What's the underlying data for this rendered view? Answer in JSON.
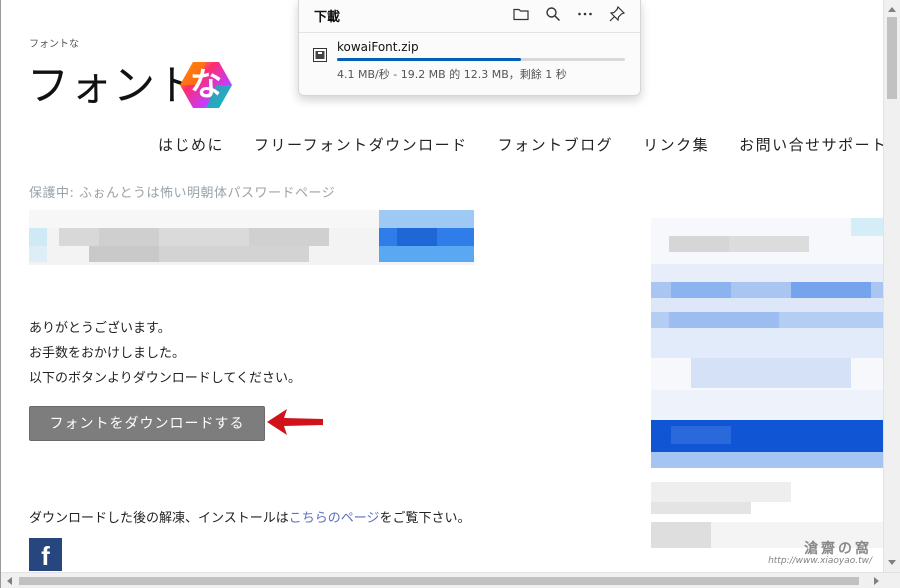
{
  "site": {
    "tagline": "フォントな",
    "logo_text": "フォント",
    "logo_mark_char": "な",
    "nav": [
      "はじめに",
      "フリーフォントダウンロード",
      "フォントブログ",
      "リンク集",
      "お問い合せサポート"
    ]
  },
  "page": {
    "protected_title": "保護中: ふぉんとうは怖い明朝体パスワードページ",
    "body_lines": [
      "ありがとうございます。",
      "お手数をおかけしました。",
      "以下のボタンよりダウンロードしてください。"
    ],
    "download_button_label": "フォントをダウンロードする",
    "install_note_before": "ダウンロードした後の解凍、インストールは",
    "install_note_link": "こちらのページ",
    "install_note_after": "をご覧下さい。",
    "facebook_glyph": "f"
  },
  "download_panel": {
    "title": "下載",
    "file_name": "kowaiFont.zip",
    "status": "4.1 MB/秒 - 19.2 MB 的 12.3 MB，剩餘 1 秒",
    "progress_fraction": 0.64,
    "tool_icons": [
      "folder-icon",
      "search-icon",
      "more-icon",
      "pin-icon"
    ]
  },
  "watermark": {
    "line1": "滄齋の窩",
    "line2": "http://www.xiaoyao.tw/"
  },
  "colors": {
    "button_gray": "#7d7d7d",
    "link_blue": "#5a6fbf",
    "progress_blue": "#005fb8",
    "facebook_blue": "#27467e",
    "arrow_red": "#d0121b",
    "protected_gray": "#9aa3a9"
  }
}
